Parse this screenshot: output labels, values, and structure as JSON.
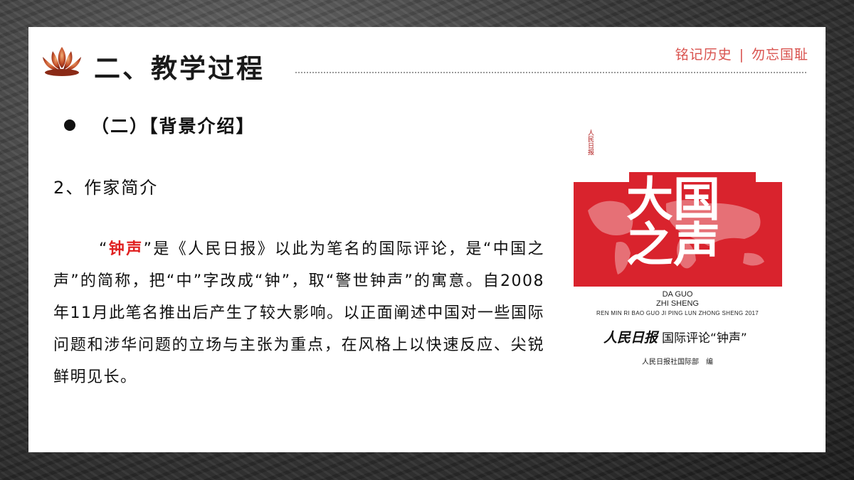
{
  "header": {
    "section_title": "二、教学过程",
    "motto_left": "铭记历史",
    "motto_sep": "|",
    "motto_right": "勿忘国耻"
  },
  "content": {
    "sub_heading": "（二）【背景介绍】",
    "author_heading": "2、作家简介",
    "paragraph": {
      "open_quote": "“",
      "highlight": "钟声",
      "rest": "”是《人民日报》以此为笔名的国际评论，是“中国之声”的简称，把“中”字改成“钟”，取“警世钟声”的寓意。自2008年11月此笔名推出后产生了较大影响。以正面阐述中国对一些国际问题和涉华问题的立场与主张为重点，在风格上以快速反应、尖锐鲜明见长。"
    }
  },
  "book_cover": {
    "tag": "人民日报",
    "big_title": "大国之声",
    "pinyin_1": "DA GUO",
    "pinyin_2": "ZHI SHENG",
    "pinyin_3": "REN MIN RI BAO GUO JI PING LUN ZHONG SHENG 2017",
    "brand": "人民日报",
    "series": "国际评论“钟声”",
    "editor": "人民日报社国际部　编"
  },
  "colors": {
    "accent_red": "#d9534f",
    "highlight_red": "#e02020",
    "cover_red": "#d9232d"
  }
}
